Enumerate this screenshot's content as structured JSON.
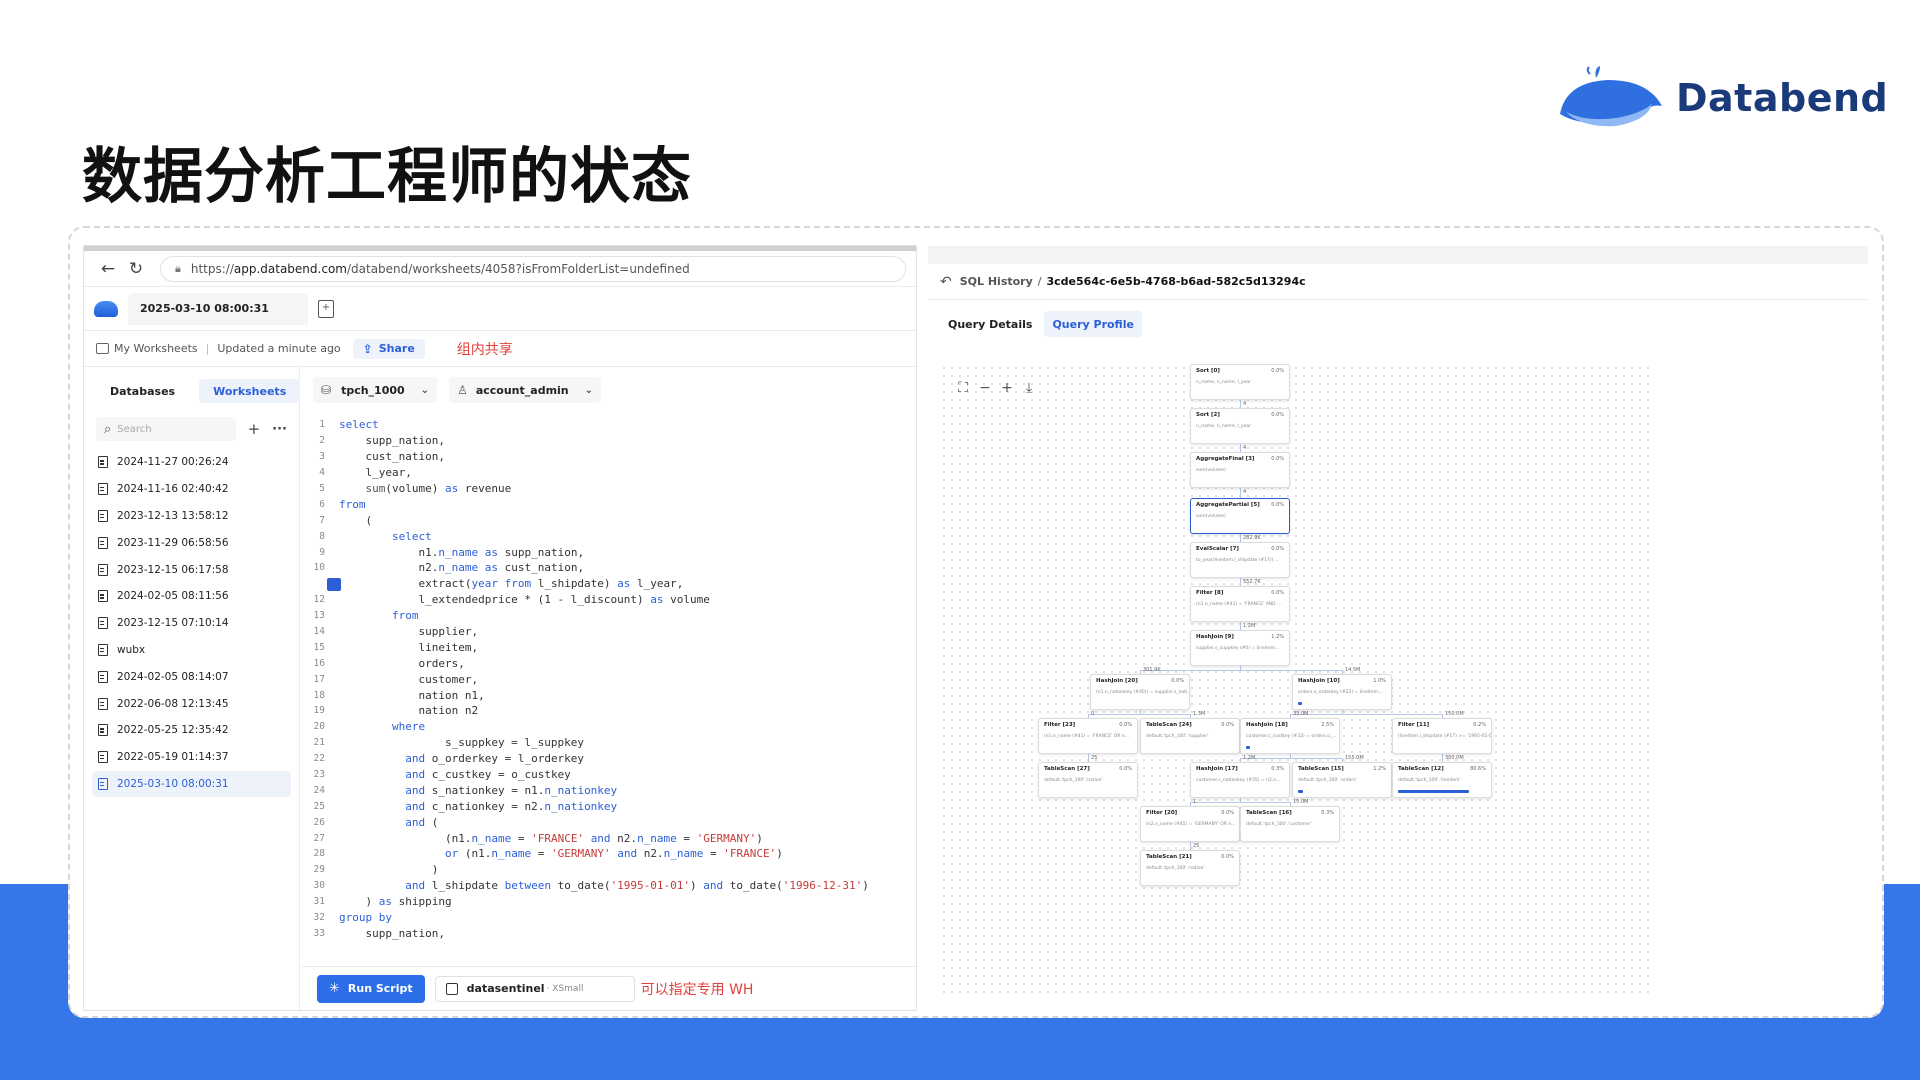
{
  "slide": {
    "title": "数据分析工程师的状态",
    "brand": "Databend"
  },
  "browser": {
    "url_prefix": "https://",
    "url_host": "app.databend.com",
    "url_path": "/databend/worksheets/4058?isFromFolderList=undefined",
    "tab_title": "2025-03-10 08:00:31",
    "breadcrumb": "My Worksheets",
    "updated": "Updated a minute ago",
    "share_label": "Share",
    "annotation_share": "组内共享"
  },
  "sidebar": {
    "tabs": [
      "Databases",
      "Worksheets"
    ],
    "search_placeholder": "Search",
    "items": [
      "2024-11-27 00:26:24",
      "2024-11-16 02:40:42",
      "2023-12-13 13:58:12",
      "2023-11-29 06:58:56",
      "2023-12-15 06:17:58",
      "2024-02-05 08:11:56",
      "2023-12-15 07:10:14",
      "wubx",
      "2024-02-05 08:14:07",
      "2022-06-08 12:13:45",
      "2022-05-25 12:35:42",
      "2022-05-19 01:14:37",
      "2025-03-10 08:00:31"
    ],
    "active_index": 12
  },
  "editor": {
    "database": "tpch_1000",
    "role": "account_admin",
    "run_line": 11,
    "code": [
      [
        [
          "kw",
          "select"
        ]
      ],
      [
        [
          "ct",
          "    supp_nation,"
        ]
      ],
      [
        [
          "ct",
          "    cust_nation,"
        ]
      ],
      [
        [
          "ct",
          "    l_year,"
        ]
      ],
      [
        [
          "ct",
          "    "
        ],
        [
          "fn",
          "sum"
        ],
        [
          "ct",
          "(volume) "
        ],
        [
          "kw",
          "as"
        ],
        [
          "ct",
          " revenue"
        ]
      ],
      [
        [
          "kw",
          "from"
        ]
      ],
      [
        [
          "ct",
          "    ("
        ]
      ],
      [
        [
          "ct",
          "        "
        ],
        [
          "kw",
          "select"
        ]
      ],
      [
        [
          "ct",
          "            n1."
        ],
        [
          "kw",
          "n_name"
        ],
        [
          "ct",
          " "
        ],
        [
          "kw",
          "as"
        ],
        [
          "ct",
          " supp_nation,"
        ]
      ],
      [
        [
          "ct",
          "            n2."
        ],
        [
          "kw",
          "n_name"
        ],
        [
          "ct",
          " "
        ],
        [
          "kw",
          "as"
        ],
        [
          "ct",
          " cust_nation,"
        ]
      ],
      [
        [
          "ct",
          "            extract("
        ],
        [
          "kw",
          "year"
        ],
        [
          "ct",
          " "
        ],
        [
          "kw",
          "from"
        ],
        [
          "ct",
          " l_shipdate) "
        ],
        [
          "kw",
          "as"
        ],
        [
          "ct",
          " l_year,"
        ]
      ],
      [
        [
          "ct",
          "            l_extendedprice * (1 - l_discount) "
        ],
        [
          "kw",
          "as"
        ],
        [
          "ct",
          " volume"
        ]
      ],
      [
        [
          "ct",
          "        "
        ],
        [
          "kw",
          "from"
        ]
      ],
      [
        [
          "ct",
          "            supplier,"
        ]
      ],
      [
        [
          "ct",
          "            lineitem,"
        ]
      ],
      [
        [
          "ct",
          "            orders,"
        ]
      ],
      [
        [
          "ct",
          "            customer,"
        ]
      ],
      [
        [
          "ct",
          "            nation n1,"
        ]
      ],
      [
        [
          "ct",
          "            nation n2"
        ]
      ],
      [
        [
          "ct",
          "        "
        ],
        [
          "kw",
          "where"
        ]
      ],
      [
        [
          "ct",
          "                s_suppkey = l_suppkey"
        ]
      ],
      [
        [
          "ct",
          "          "
        ],
        [
          "kw",
          "and"
        ],
        [
          "ct",
          " o_orderkey = l_orderkey"
        ]
      ],
      [
        [
          "ct",
          "          "
        ],
        [
          "kw",
          "and"
        ],
        [
          "ct",
          " c_custkey = o_custkey"
        ]
      ],
      [
        [
          "ct",
          "          "
        ],
        [
          "kw",
          "and"
        ],
        [
          "ct",
          " s_nationkey = n1."
        ],
        [
          "kw",
          "n_nationkey"
        ]
      ],
      [
        [
          "ct",
          "          "
        ],
        [
          "kw",
          "and"
        ],
        [
          "ct",
          " c_nationkey = n2."
        ],
        [
          "kw",
          "n_nationkey"
        ]
      ],
      [
        [
          "ct",
          "          "
        ],
        [
          "kw",
          "and"
        ],
        [
          "ct",
          " ("
        ]
      ],
      [
        [
          "ct",
          "                (n1."
        ],
        [
          "kw",
          "n_name"
        ],
        [
          "ct",
          " = "
        ],
        [
          "str",
          "'FRANCE'"
        ],
        [
          "ct",
          " "
        ],
        [
          "kw",
          "and"
        ],
        [
          "ct",
          " n2."
        ],
        [
          "kw",
          "n_name"
        ],
        [
          "ct",
          " = "
        ],
        [
          "str",
          "'GERMANY'"
        ],
        [
          "ct",
          ")"
        ]
      ],
      [
        [
          "ct",
          "                "
        ],
        [
          "kw",
          "or"
        ],
        [
          "ct",
          " (n1."
        ],
        [
          "kw",
          "n_name"
        ],
        [
          "ct",
          " = "
        ],
        [
          "str",
          "'GERMANY'"
        ],
        [
          "ct",
          " "
        ],
        [
          "kw",
          "and"
        ],
        [
          "ct",
          " n2."
        ],
        [
          "kw",
          "n_name"
        ],
        [
          "ct",
          " = "
        ],
        [
          "str",
          "'FRANCE'"
        ],
        [
          "ct",
          ")"
        ]
      ],
      [
        [
          "ct",
          "              )"
        ]
      ],
      [
        [
          "ct",
          "          "
        ],
        [
          "kw",
          "and"
        ],
        [
          "ct",
          " l_shipdate "
        ],
        [
          "kw",
          "between"
        ],
        [
          "ct",
          " to_date("
        ],
        [
          "str",
          "'1995-01-01'"
        ],
        [
          "ct",
          ") "
        ],
        [
          "kw",
          "and"
        ],
        [
          "ct",
          " to_date("
        ],
        [
          "str",
          "'1996-12-31'"
        ],
        [
          "ct",
          ")"
        ]
      ],
      [
        [
          "ct",
          "    ) "
        ],
        [
          "kw",
          "as"
        ],
        [
          "ct",
          " shipping"
        ]
      ],
      [
        [
          "kw",
          "group by"
        ]
      ],
      [
        [
          "ct",
          "    supp_nation,"
        ]
      ]
    ],
    "run_label": "Run Script",
    "warehouse": "datasentinel",
    "warehouse_size": "· XSmall",
    "annotation_wh": "可以指定专用 WH"
  },
  "profile": {
    "history_label": "SQL History",
    "query_id": "3cde564c-6e5b-4768-b6ad-582c5d13294c",
    "tabs": [
      "Query Details",
      "Query Profile"
    ],
    "active_tab": 1,
    "nodes": [
      {
        "title": "Sort [0]",
        "pct": "0.0%",
        "sub": "n_name, n_name, l_year"
      },
      {
        "title": "Sort [2]",
        "pct": "0.0%",
        "sub": "n_name, n_name, l_year"
      },
      {
        "title": "AggregateFinal [3]",
        "pct": "0.0%",
        "sub": "sum(volume)"
      },
      {
        "title": "AggregatePartial [5]",
        "pct": "0.0%",
        "sub": "sum(volume)"
      },
      {
        "title": "EvalScalar [7]",
        "pct": "0.0%",
        "sub": "to_year(lineitem.l_shipdate (#17)) ..."
      },
      {
        "title": "Filter [8]",
        "pct": "0.0%",
        "sub": "(n1.n_name (#41) = 'FRANCE' AND ..."
      },
      {
        "title": "HashJoin [9]",
        "pct": "1.2%",
        "sub": "supplier.s_suppkey (#0) = lineitem..."
      },
      {
        "title": "HashJoin [20]",
        "pct": "0.0%",
        "sub": "(n1.n_nationkey (#40)) = supplier.s_nati..."
      },
      {
        "title": "HashJoin [10]",
        "pct": "1.0%",
        "sub": "orders.o_orderkey (#22) = lineitem..."
      },
      {
        "title": "Filter [23]",
        "pct": "0.0%",
        "sub": "(n1.n_name (#41) = 'FRANCE' OR n..."
      },
      {
        "title": "TableScan [24]",
        "pct": "0.0%",
        "sub": "default.'tpch_100'.'supplier'"
      },
      {
        "title": "HashJoin [18]",
        "pct": "2.5%",
        "sub": "customer.c_custkey (#32) = orders.o_..."
      },
      {
        "title": "Filter [11]",
        "pct": "0.2%",
        "sub": "(lineitem.l_shipdate (#17) >= '1995-01-01'..."
      },
      {
        "title": "TableScan [27]",
        "pct": "0.0%",
        "sub": "default.'tpch_100'.'nation'"
      },
      {
        "title": "HashJoin [17]",
        "pct": "0.3%",
        "sub": "customer.c_nationkey (#35) = n2.n..."
      },
      {
        "title": "TableScan [15]",
        "pct": "1.2%",
        "sub": "default.'tpch_100'.'orders'"
      },
      {
        "title": "TableScan [12]",
        "pct": "80.6%",
        "sub": "default.'tpch_100'.'lineitem'"
      },
      {
        "title": "Filter [20]",
        "pct": "0.0%",
        "sub": "(n2.n_name (#45) = 'GERMANY' OR n..."
      },
      {
        "title": "TableScan [16]",
        "pct": "0.3%",
        "sub": "default.'tpch_100'.'customer'"
      },
      {
        "title": "TableScan [21]",
        "pct": "0.0%",
        "sub": "default.'tpch_100'.'nation'"
      }
    ],
    "edge_labels": [
      "4",
      "4",
      "4",
      "282.9K",
      "552.7K",
      "1.2M",
      "301.9K",
      "14.5M",
      "0",
      "1.3M",
      "33.0M",
      "150.0M",
      "25",
      "1.2M",
      "155.0M",
      "300.0M",
      "1",
      "15.0M",
      "25"
    ],
    "node_fill": [
      0,
      0,
      0,
      0,
      0,
      0,
      0,
      0,
      0.04,
      0,
      0,
      0.02,
      0,
      0,
      0,
      0.06,
      0.806,
      0,
      0,
      0
    ]
  }
}
